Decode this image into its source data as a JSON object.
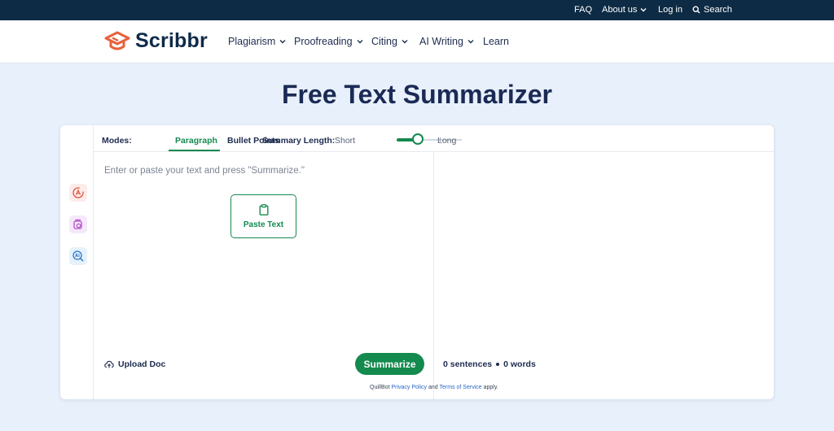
{
  "topbar": {
    "faq": "FAQ",
    "about": "About us",
    "login": "Log in",
    "search": "Search"
  },
  "brand": {
    "name": "Scribbr",
    "color": "#e8613c"
  },
  "nav": {
    "items": [
      {
        "label": "Plagiarism",
        "has_dropdown": true
      },
      {
        "label": "Proofreading",
        "has_dropdown": true
      },
      {
        "label": "Citing",
        "has_dropdown": true
      },
      {
        "label": "AI Writing",
        "has_dropdown": true
      },
      {
        "label": "Learn",
        "has_dropdown": false
      }
    ]
  },
  "page": {
    "title": "Free Text Summarizer"
  },
  "tool": {
    "modes_label": "Modes:",
    "modes": [
      {
        "label": "Paragraph",
        "active": true
      },
      {
        "label": "Bullet Points",
        "active": false
      }
    ],
    "summary_length_label": "Summary Length:",
    "length_short": "Short",
    "length_long": "Long",
    "length_value_percent": 33,
    "input_placeholder": "Enter or paste your text and press \"Summarize.\"",
    "paste_label": "Paste Text",
    "upload_label": "Upload Doc",
    "summarize_label": "Summarize",
    "sentences_count": "0 sentences",
    "words_count": "0 words",
    "legal": {
      "prefix": "QuillBot",
      "privacy": "Privacy Policy",
      "and": "and",
      "terms": "Terms of Service",
      "suffix": "apply."
    },
    "rail_icons": [
      "paraphraser-icon",
      "grammar-check-icon",
      "ai-detector-icon"
    ]
  },
  "colors": {
    "topbar_bg": "#0d2b45",
    "accent_green": "#148a4e",
    "page_bg": "#e8f0fb",
    "title_navy": "#1b2a55"
  }
}
